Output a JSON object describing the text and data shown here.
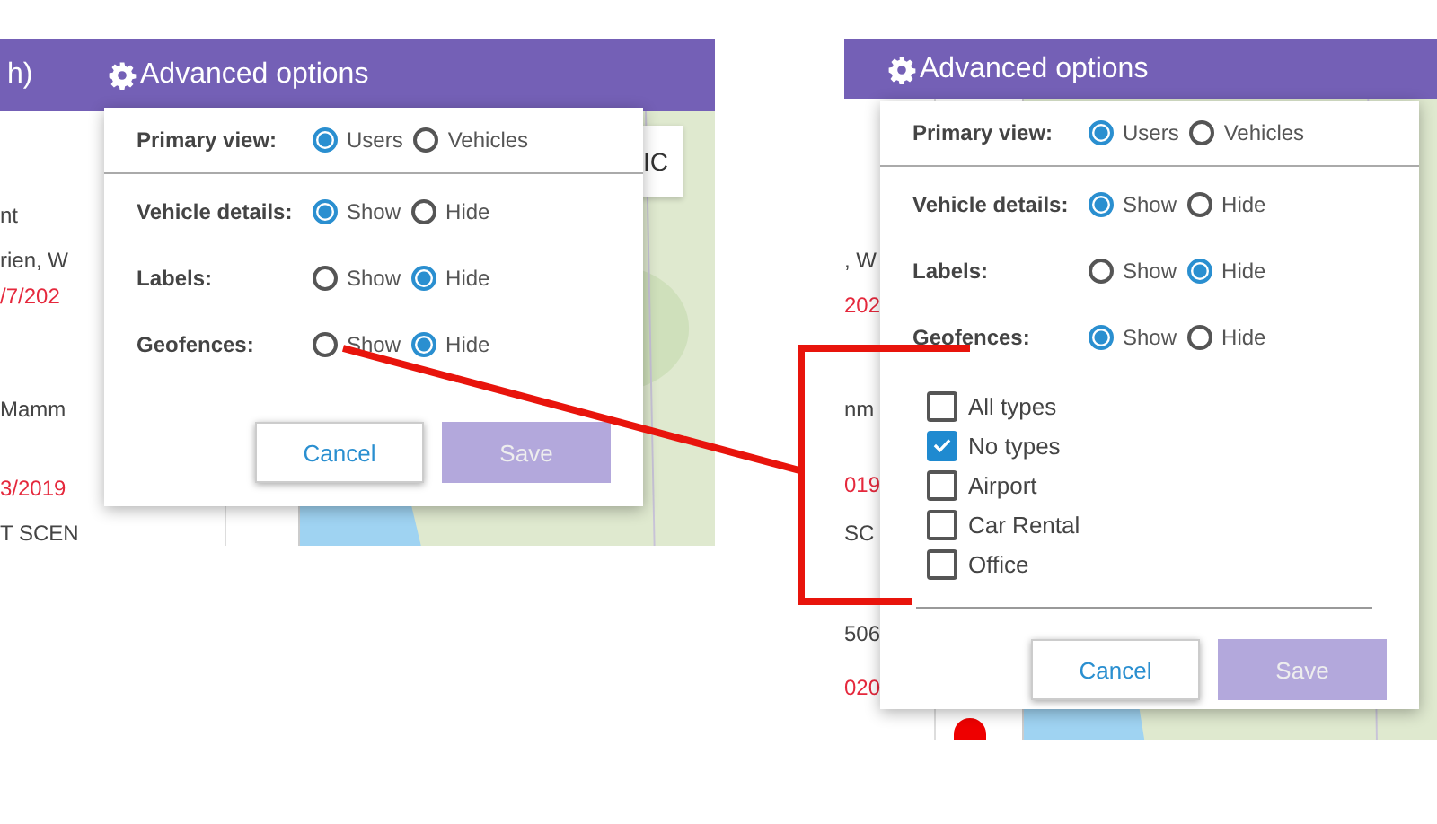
{
  "panels": [
    {
      "header_fragment": "h)",
      "title": "Advanced options",
      "map_button": "IC",
      "list": [
        {
          "text": "nt",
          "kind": "text"
        },
        {
          "text": "rien, W",
          "kind": "text"
        },
        {
          "text": "/7/202",
          "kind": "date"
        },
        {
          "text": "Mamm",
          "kind": "text"
        },
        {
          "text": "3/2019",
          "kind": "date"
        },
        {
          "text": "T SCEN",
          "kind": "text"
        }
      ],
      "dialog": {
        "settings": [
          {
            "label": "Primary view:",
            "choices": [
              {
                "label": "Users",
                "selected": true
              },
              {
                "label": "Vehicles",
                "selected": false
              }
            ]
          },
          {
            "label": "Vehicle details:",
            "choices": [
              {
                "label": "Show",
                "selected": true
              },
              {
                "label": "Hide",
                "selected": false
              }
            ]
          },
          {
            "label": "Labels:",
            "choices": [
              {
                "label": "Show",
                "selected": false
              },
              {
                "label": "Hide",
                "selected": true
              }
            ]
          },
          {
            "label": "Geofences:",
            "choices": [
              {
                "label": "Show",
                "selected": false
              },
              {
                "label": "Hide",
                "selected": true
              }
            ]
          }
        ],
        "buttons": [
          {
            "label": "Cancel",
            "disabled": false
          },
          {
            "label": "Save",
            "disabled": true
          }
        ]
      }
    },
    {
      "title": "Advanced options",
      "map_marker": true,
      "list": [
        {
          "text": ", W",
          "kind": "text"
        },
        {
          "text": "202",
          "kind": "date"
        },
        {
          "text": "nm",
          "kind": "text"
        },
        {
          "text": "019",
          "kind": "date"
        },
        {
          "text": "SC",
          "kind": "text"
        },
        {
          "text": "506",
          "kind": "text"
        },
        {
          "text": "020",
          "kind": "date"
        }
      ],
      "dialog": {
        "settings": [
          {
            "label": "Primary view:",
            "choices": [
              {
                "label": "Users",
                "selected": true
              },
              {
                "label": "Vehicles",
                "selected": false
              }
            ]
          },
          {
            "label": "Vehicle details:",
            "choices": [
              {
                "label": "Show",
                "selected": true
              },
              {
                "label": "Hide",
                "selected": false
              }
            ]
          },
          {
            "label": "Labels:",
            "choices": [
              {
                "label": "Show",
                "selected": false
              },
              {
                "label": "Hide",
                "selected": true
              }
            ]
          },
          {
            "label": "Geofences:",
            "choices": [
              {
                "label": "Show",
                "selected": true
              },
              {
                "label": "Hide",
                "selected": false
              }
            ]
          }
        ],
        "geofence_types": [
          {
            "label": "All types",
            "checked": false
          },
          {
            "label": "No types",
            "checked": true
          },
          {
            "label": "Airport",
            "checked": false
          },
          {
            "label": "Car Rental",
            "checked": false
          },
          {
            "label": "Office",
            "checked": false
          }
        ],
        "buttons": [
          {
            "label": "Cancel",
            "disabled": false
          },
          {
            "label": "Save",
            "disabled": true
          }
        ]
      }
    }
  ]
}
